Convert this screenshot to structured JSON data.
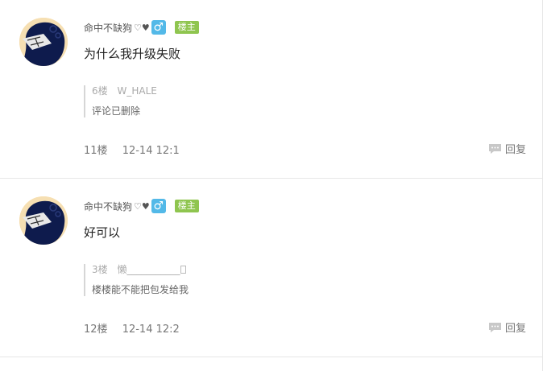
{
  "posts": [
    {
      "username": "命中不缺狗",
      "hearts": "♡♥",
      "male_symbol": "♂",
      "lz_badge": "楼主",
      "content": "为什么我升级失败",
      "quote": {
        "floor": "6楼",
        "user": "W_HALE",
        "text": "评论已删除",
        "has_box": false
      },
      "floor": "11楼",
      "time": "12-14 12:1",
      "reply_label": "回复"
    },
    {
      "username": "命中不缺狗",
      "hearts": "♡♥",
      "male_symbol": "♂",
      "lz_badge": "楼主",
      "content": "好可以",
      "quote": {
        "floor": "3楼",
        "user": "懒___________",
        "text": "楼楼能不能把包发给我",
        "has_box": true
      },
      "floor": "12楼",
      "time": "12-14 12:2",
      "reply_label": "回复"
    }
  ]
}
